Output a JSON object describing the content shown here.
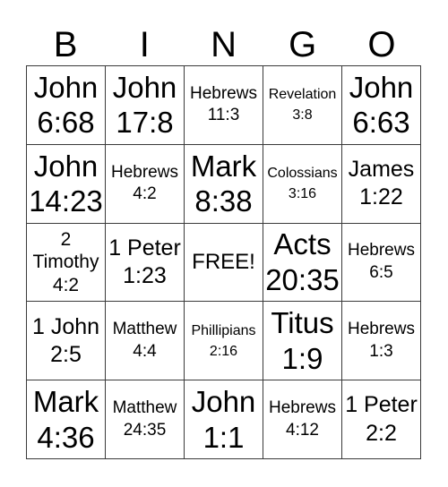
{
  "header": [
    "B",
    "I",
    "N",
    "G",
    "O"
  ],
  "cells": [
    [
      {
        "text": "John\n6:68",
        "size": "s-xl"
      },
      {
        "text": "John\n17:8",
        "size": "s-xl"
      },
      {
        "text": "Hebrews\n11:3",
        "size": "s-s"
      },
      {
        "text": "Revelation\n3:8",
        "size": "s-xs"
      },
      {
        "text": "John\n6:63",
        "size": "s-xl"
      }
    ],
    [
      {
        "text": "John\n14:23",
        "size": "s-xl"
      },
      {
        "text": "Hebrews\n4:2",
        "size": "s-s"
      },
      {
        "text": "Mark\n8:38",
        "size": "s-xl"
      },
      {
        "text": "Colossians\n3:16",
        "size": "s-xs"
      },
      {
        "text": "James\n1:22",
        "size": "s-l"
      }
    ],
    [
      {
        "text": "2\nTimothy\n4:2",
        "size": "s-m"
      },
      {
        "text": "1 Peter\n1:23",
        "size": "s-l"
      },
      {
        "text": "FREE!",
        "size": "s-free"
      },
      {
        "text": "Acts\n20:35",
        "size": "s-xl"
      },
      {
        "text": "Hebrews\n6:5",
        "size": "s-s"
      }
    ],
    [
      {
        "text": "1 John\n2:5",
        "size": "s-l"
      },
      {
        "text": "Matthew\n4:4",
        "size": "s-s"
      },
      {
        "text": "Phillipians\n2:16",
        "size": "s-xs"
      },
      {
        "text": "Titus\n1:9",
        "size": "s-xl"
      },
      {
        "text": "Hebrews\n1:3",
        "size": "s-s"
      }
    ],
    [
      {
        "text": "Mark\n4:36",
        "size": "s-xl"
      },
      {
        "text": "Matthew\n24:35",
        "size": "s-s"
      },
      {
        "text": "John\n1:1",
        "size": "s-xl"
      },
      {
        "text": "Hebrews\n4:12",
        "size": "s-s"
      },
      {
        "text": "1 Peter\n2:2",
        "size": "s-l"
      }
    ]
  ]
}
